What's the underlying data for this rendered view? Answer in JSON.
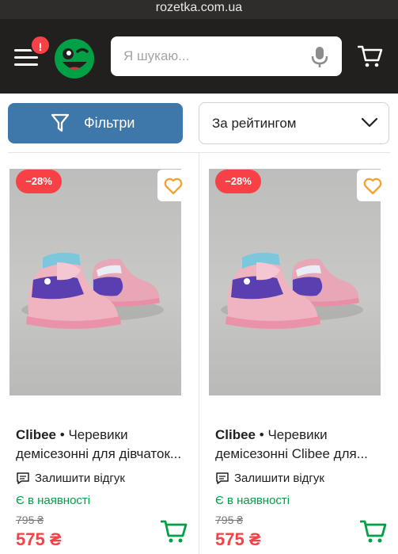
{
  "browser": {
    "url": "rozetka.com.ua"
  },
  "header": {
    "notification_badge": "!",
    "search_placeholder": "Я шукаю...",
    "icons": [
      "menu-icon",
      "logo-smile-icon",
      "microphone-icon",
      "cart-icon"
    ]
  },
  "toolbar": {
    "filters_label": "Фільтри",
    "sort_label": "За рейтингом"
  },
  "products": [
    {
      "discount": "−28%",
      "brand": "Clibee",
      "separator": " • ",
      "title_rest": "Черевики",
      "title_line2": "демісезонні для дівчаток...",
      "review_label": "Залишити відгук",
      "availability": "Є в наявності",
      "old_price": "795 ₴",
      "price": "575 ₴"
    },
    {
      "discount": "−28%",
      "brand": "Clibee",
      "separator": " • ",
      "title_rest": "Черевики",
      "title_line2": "демісезонні Clibee для...",
      "review_label": "Залишити відгук",
      "availability": "Є в наявності",
      "old_price": "795 ₴",
      "price": "575 ₴"
    }
  ],
  "colors": {
    "header_bg": "#221f1f",
    "accent_blue": "#3e77aa",
    "discount_red": "#f84147",
    "stock_green": "#00a046",
    "favorite_orange": "#f4a233",
    "logo_green": "#00a046"
  }
}
